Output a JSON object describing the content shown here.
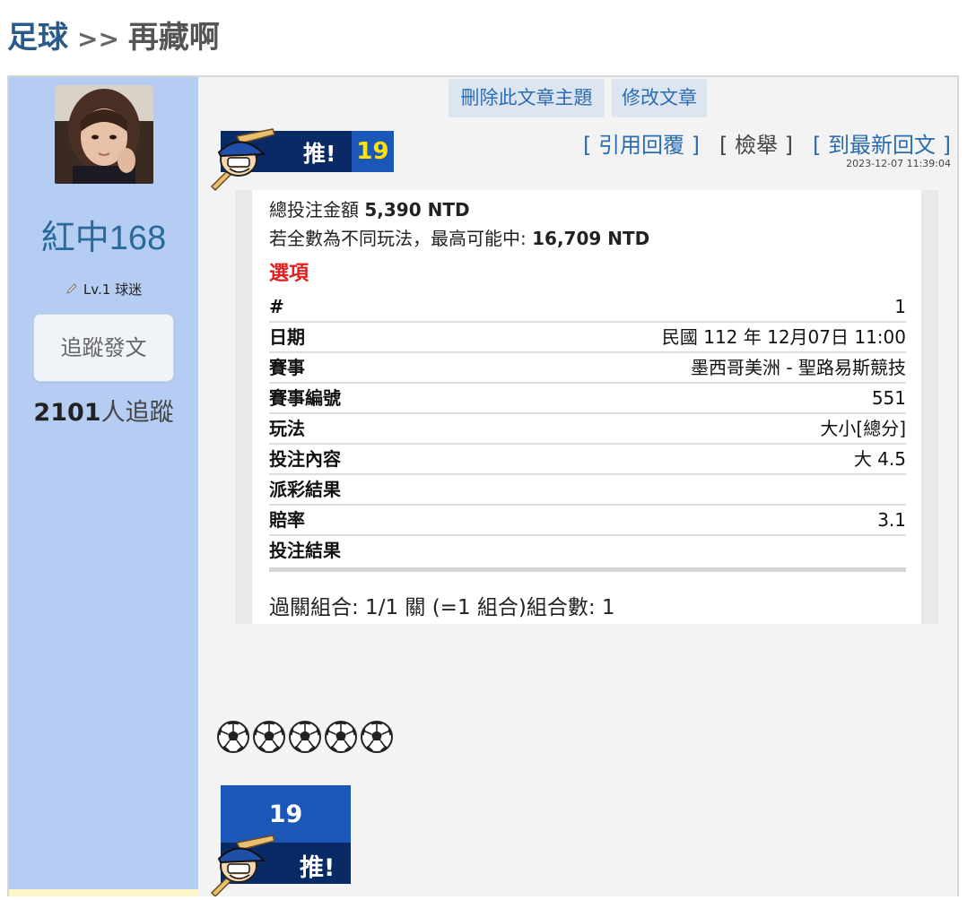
{
  "breadcrumb": {
    "board": "足球",
    "separator": ">>",
    "title": "再藏啊"
  },
  "author": {
    "name": "紅中168",
    "level": "Lv.1 球迷",
    "follow_label": "追蹤發文",
    "follower_count": "2101",
    "follower_suffix": "人追蹤"
  },
  "manage": {
    "delete_label": "刪除此文章主題",
    "edit_label": "修改文章"
  },
  "push": {
    "label": "推!",
    "count": "19"
  },
  "actions": {
    "quote": "引用回覆",
    "report": "檢舉",
    "latest": "到最新回文"
  },
  "post_time": "2023-12-07 11:39:04",
  "bet": {
    "total_label": "總投注金額",
    "total_value": "5,390 NTD",
    "max_label": "若全數為不同玩法，最高可能中:",
    "max_value": "16,709 NTD",
    "options_title": "選項",
    "rows": [
      {
        "k": "#",
        "v": "1"
      },
      {
        "k": "日期",
        "v": "民國 112 年 12月07日 11:00"
      },
      {
        "k": "賽事",
        "v": "墨西哥美洲 - 聖路易斯競技"
      },
      {
        "k": "賽事編號",
        "v": "551"
      },
      {
        "k": "玩法",
        "v": "大小[總分]"
      },
      {
        "k": "投注內容",
        "v": "大 4.5"
      },
      {
        "k": "派彩結果",
        "v": ""
      },
      {
        "k": "賠率",
        "v": "3.1"
      },
      {
        "k": "投注結果",
        "v": ""
      }
    ],
    "combo": "過關組合: 1/1 關 (=1 組合)組合數: 1"
  },
  "content_emoji_count": 5,
  "bottom_push": {
    "count": "19",
    "label": "推!"
  },
  "colors": {
    "sidebar": "#b5cdf3",
    "link": "#2b6cb0",
    "push_dark": "#0a2a66",
    "push_blue": "#1a57b8",
    "count_yellow": "#ffe300",
    "option_red": "#e02020"
  }
}
